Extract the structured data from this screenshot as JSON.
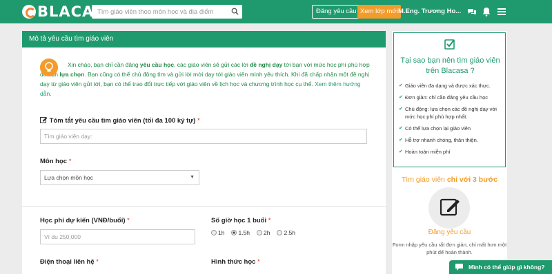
{
  "nav": {
    "logo_text": "BLACASA",
    "search_placeholder": "Tìm giáo viên theo môn học và địa điểm",
    "post_request_label": "Đăng yêu cầu",
    "browse_classes_label": "Xem lớp mới",
    "user_name": "M.Eng. Trương Ho..."
  },
  "form": {
    "panel_title": "Mô tả yêu cầu tìm giáo viên",
    "intro": {
      "p1": "Xin chào, bạn chỉ cần đăng ",
      "b1": "yêu cầu học",
      "p2": ", các giáo viên sẽ gửi các lời ",
      "b2": "đề nghị dạy",
      "p3": " tới bạn với mức học phí phù hợp để bạn ",
      "b3": "lựa chọn",
      "p4": ". Bạn cũng có thể chủ động tìm và gửi lời mời dạy tới giáo viên mình yêu thích. Khi đã chấp nhận một đề nghị dạy từ giáo viên gửi tới, bạn có thể trao đổi trực tiếp với giáo viên về lịch học và chương trình học cụ thể. ",
      "link": "Xem thêm hướng dẫn."
    },
    "summary": {
      "label": "Tóm tắt yêu cầu tìm giáo viên (tối đa 100 ký tự)",
      "required": "*",
      "placeholder": "Tìm giáo viên dạy:"
    },
    "subject": {
      "label": "Môn học",
      "required": "*",
      "value": "Lựa chọn môn học"
    },
    "fee": {
      "label": "Học phí dự kiến (VNĐ/buổi)",
      "required": "*",
      "placeholder": "Ví du 250,000"
    },
    "hours": {
      "label": "Số giờ học 1 buổi",
      "required": "*",
      "options": [
        "1h",
        "1.5h",
        "2h",
        "2.5h"
      ],
      "selected": "1.5h"
    },
    "phone": {
      "label": "Điện thoại liên hệ",
      "required": "*"
    },
    "mode": {
      "label": "Hình thức học",
      "required": "*"
    }
  },
  "sidebar": {
    "why_title": "Tại sao bạn nên tìm giáo viên trên Blacasa ?",
    "reasons": [
      "Giáo viên đa dạng và được xác thực.",
      "Đơn giản: chỉ cần đăng yêu cầu học",
      "Chủ động: lựa chọn các đề nghị dạy với mức học phí phù hợp nhất.",
      "Có thể lựa chọn lại giáo viên",
      "Hỗ trợ nhanh chóng, thân thiện.",
      "Hoàn toàn miễn phí"
    ],
    "steps_title_a": "Tìm giáo viên ",
    "steps_title_b": "chỉ với 3 bước",
    "step1_name": "Đăng yêu cầu",
    "step1_desc": "Form nhập yêu cầu rất đơn giản, chỉ mất hơn một phút để hoàn thành."
  },
  "help": {
    "label": "Mình có thể giúp gì không?"
  },
  "colors": {
    "brand_green": "#1f9a6f",
    "accent_orange": "#f39c2b"
  }
}
